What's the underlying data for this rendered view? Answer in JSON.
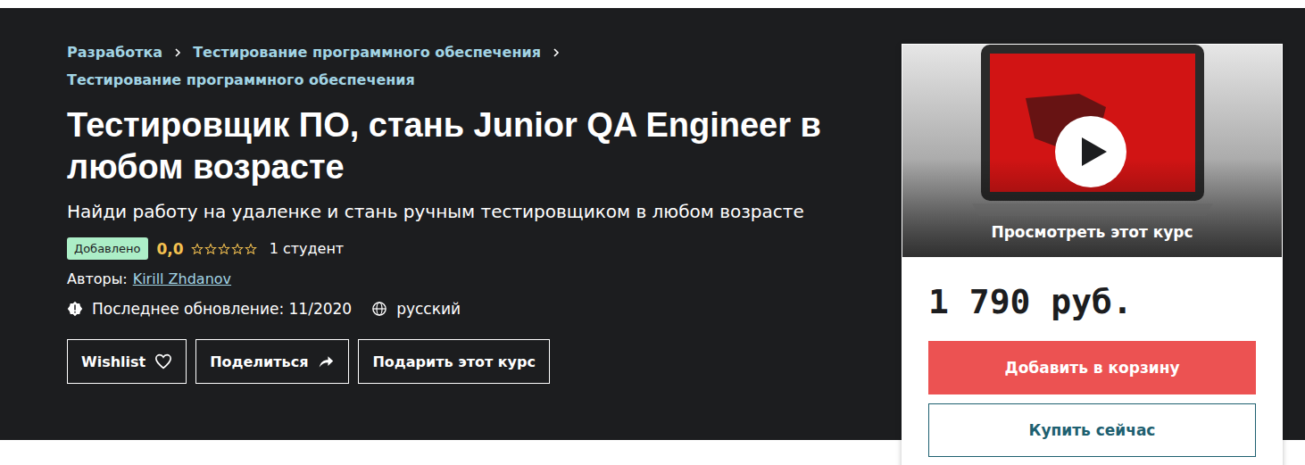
{
  "breadcrumbs": [
    {
      "label": "Разработка"
    },
    {
      "label": "Тестирование программного обеспечения"
    },
    {
      "label": "Тестирование программного обеспечения"
    }
  ],
  "title": "Тестировщик ПО, стань Junior QA Engineer в любом возрасте",
  "subtitle": "Найди работу на удаленке и стань ручным тестировщиком в любом возрасте",
  "badge": "Добавлено",
  "rating": {
    "value": "0,0",
    "stars": 0
  },
  "students": "1 студент",
  "authors": {
    "label": "Авторы:",
    "names": [
      "Kirill Zhdanov"
    ]
  },
  "updated": "Последнее обновление: 11/2020",
  "language": "русский",
  "actions": [
    {
      "label": "Wishlist",
      "kind": "wishlist"
    },
    {
      "label": "Поделиться",
      "kind": "share"
    },
    {
      "label": "Подарить этот курс",
      "kind": "gift"
    }
  ],
  "preview": {
    "caption": "Просмотреть этот курс"
  },
  "price": "1 790 руб.",
  "buttons": [
    {
      "label": "Добавить в корзину",
      "kind": "primary"
    },
    {
      "label": "Купить сейчас",
      "kind": "secondary"
    }
  ]
}
